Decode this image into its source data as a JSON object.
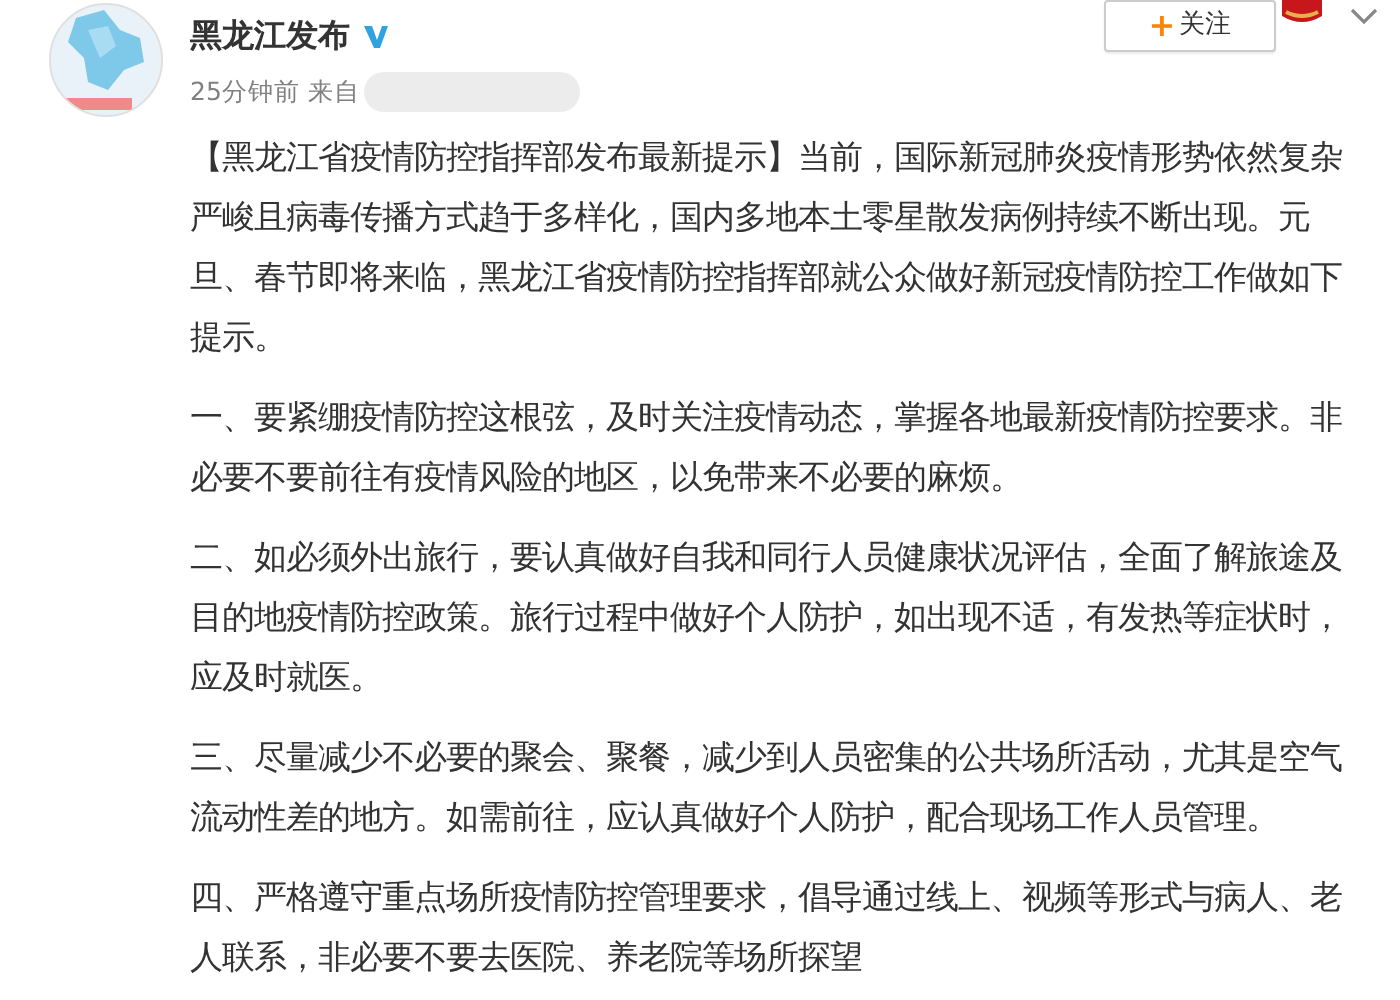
{
  "post": {
    "author": {
      "name": "黑龙江发布",
      "verified": true
    },
    "meta": {
      "time": "25分钟前",
      "source_label": "来自"
    },
    "follow_button": {
      "plus": "+",
      "label": "关注"
    },
    "paragraphs": [
      "【黑龙江省疫情防控指挥部发布最新提示】当前，国际新冠肺炎疫情形势依然复杂严峻且病毒传播方式趋于多样化，国内多地本土零星散发病例持续不断出现。元旦、春节即将来临，黑龙江省疫情防控指挥部就公众做好新冠疫情防控工作做如下提示。",
      "一、要紧绷疫情防控这根弦，及时关注疫情动态，掌握各地最新疫情防控要求。非必要不要前往有疫情风险的地区，以免带来不必要的麻烦。",
      "二、如必须外出旅行，要认真做好自我和同行人员健康状况评估，全面了解旅途及目的地疫情防控政策。旅行过程中做好个人防护，如出现不适，有发热等症状时，应及时就医。",
      "三、尽量减少不必要的聚会、聚餐，减少到人员密集的公共场所活动，尤其是空气流动性差的地方。如需前往，应认真做好个人防护，配合现场工作人员管理。",
      "四、严格遵守重点场所疫情防控管理要求，倡导通过线上、视频等形式与病人、老人联系，非必要不要去医院、养老院等场所探望"
    ]
  }
}
